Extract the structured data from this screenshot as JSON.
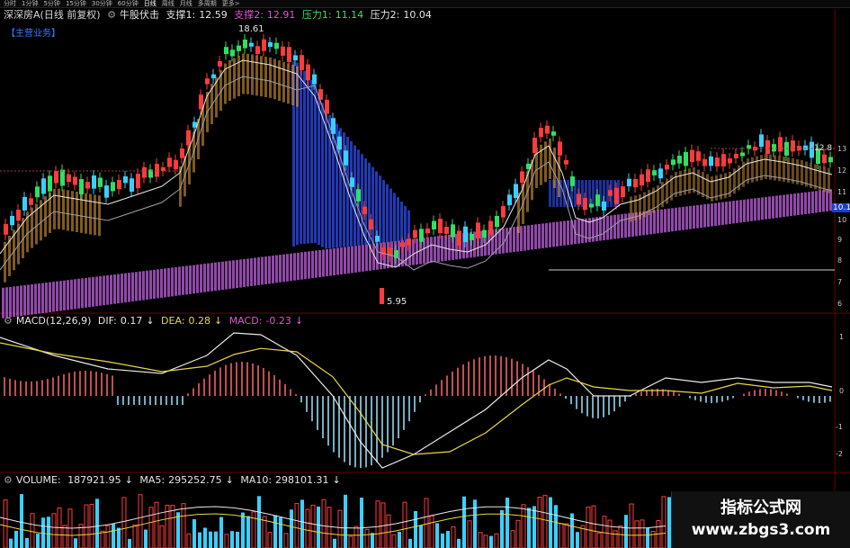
{
  "toolbar": {
    "tabs": [
      "分时",
      "1分钟",
      "5分钟",
      "15分钟",
      "30分钟",
      "60分钟",
      "日线",
      "周线",
      "月线",
      "多周期",
      "更多>"
    ],
    "active": "日线"
  },
  "main_panel": {
    "title": "深深房A(日线 前复权)",
    "indicator": "牛股伏击",
    "support1_label": "支撑1:",
    "support1_value": "12.59",
    "support2_label": "支撑2:",
    "support2_value": "12.91",
    "pressure1_label": "压力1:",
    "pressure1_value": "11.14",
    "pressure2_label": "压力2:",
    "pressure2_value": "10.04",
    "tag": "【主营业务】",
    "high_label": "18.61",
    "low_label": "5.95",
    "right_label_1": "12.8",
    "right_label_2": "10.1",
    "right_axis": [
      "13",
      "12",
      "11",
      "10",
      "9",
      "8",
      "7",
      "6"
    ]
  },
  "macd_panel": {
    "title": "MACD(12,26,9)",
    "dif_label": "DIF:",
    "dif_value": "0.17",
    "dea_label": "DEA:",
    "dea_value": "0.28",
    "macd_label": "MACD:",
    "macd_value": "-0.23",
    "right_axis": [
      "1",
      "0",
      "-1",
      "-2"
    ]
  },
  "volume_panel": {
    "title": "VOLUME:",
    "volume_value": "187921.95",
    "ma5_label": "MA5:",
    "ma5_value": "295252.75",
    "ma10_label": "MA10:",
    "ma10_value": "298101.31"
  },
  "watermark": {
    "line1": "指标公式网",
    "line2": "www.zbgs3.com"
  },
  "colors": {
    "up": "#ff3b3b",
    "down": "#39d0ff",
    "ribbon": "#c060e0",
    "blue_band": "#3050ff",
    "dif": "#e8e8e8",
    "dea": "#e8d64a"
  }
}
